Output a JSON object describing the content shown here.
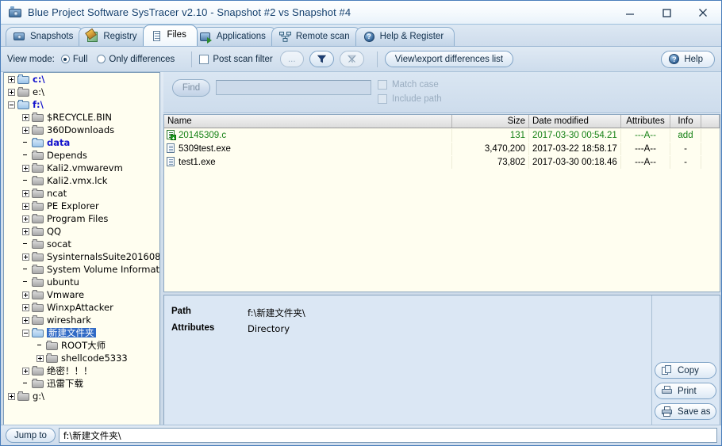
{
  "window": {
    "title": "Blue Project Software SysTracer v2.10 - Snapshot #2 vs Snapshot #4",
    "icon": "camera-icon",
    "minimize": "–",
    "maximize": "□",
    "close": "✕"
  },
  "tabs": [
    {
      "label": "Snapshots",
      "icon": "camera-icon",
      "active": false
    },
    {
      "label": "Registry",
      "icon": "registry-icon",
      "active": false
    },
    {
      "label": "Files",
      "icon": "document-icon",
      "active": true
    },
    {
      "label": "Applications",
      "icon": "application-icon",
      "active": false
    },
    {
      "label": "Remote scan",
      "icon": "network-icon",
      "active": false
    },
    {
      "label": "Help & Register",
      "icon": "help-icon",
      "active": false
    }
  ],
  "toolbar": {
    "view_mode_label": "View mode:",
    "radio_full": "Full",
    "radio_only_differences": "Only differences",
    "post_scan_filter": "Post scan filter",
    "ellipsis_button": "...",
    "filter_button": "filter-icon",
    "clear_filter_button": "clear-filter-icon",
    "view_export": "View\\export differences list",
    "help": "Help"
  },
  "find": {
    "button": "Find",
    "value": "",
    "placeholder": "",
    "match_case": "Match case",
    "include_path": "Include path"
  },
  "tree": [
    {
      "label": "c:\\",
      "indent": 0,
      "expander": "plus",
      "changed": true,
      "selected": false,
      "folder": "blue"
    },
    {
      "label": "e:\\",
      "indent": 0,
      "expander": "plus",
      "changed": false,
      "selected": false,
      "folder": "gray"
    },
    {
      "label": "f:\\",
      "indent": 0,
      "expander": "minus",
      "changed": true,
      "selected": false,
      "folder": "blue"
    },
    {
      "label": "$RECYCLE.BIN",
      "indent": 1,
      "expander": "plus",
      "changed": false,
      "selected": false,
      "folder": "gray"
    },
    {
      "label": "360Downloads",
      "indent": 1,
      "expander": "plus",
      "changed": false,
      "selected": false,
      "folder": "gray"
    },
    {
      "label": "data",
      "indent": 1,
      "expander": "none",
      "changed": true,
      "selected": false,
      "folder": "blue"
    },
    {
      "label": "Depends",
      "indent": 1,
      "expander": "none",
      "changed": false,
      "selected": false,
      "folder": "gray"
    },
    {
      "label": "Kali2.vmwarevm",
      "indent": 1,
      "expander": "plus",
      "changed": false,
      "selected": false,
      "folder": "gray"
    },
    {
      "label": "Kali2.vmx.lck",
      "indent": 1,
      "expander": "none",
      "changed": false,
      "selected": false,
      "folder": "gray"
    },
    {
      "label": "ncat",
      "indent": 1,
      "expander": "plus",
      "changed": false,
      "selected": false,
      "folder": "gray"
    },
    {
      "label": "PE Explorer",
      "indent": 1,
      "expander": "plus",
      "changed": false,
      "selected": false,
      "folder": "gray"
    },
    {
      "label": "Program Files",
      "indent": 1,
      "expander": "plus",
      "changed": false,
      "selected": false,
      "folder": "gray"
    },
    {
      "label": "QQ",
      "indent": 1,
      "expander": "plus",
      "changed": false,
      "selected": false,
      "folder": "gray"
    },
    {
      "label": "socat",
      "indent": 1,
      "expander": "none",
      "changed": false,
      "selected": false,
      "folder": "gray"
    },
    {
      "label": "SysinternalsSuite201608",
      "indent": 1,
      "expander": "plus",
      "changed": false,
      "selected": false,
      "folder": "gray"
    },
    {
      "label": "System Volume Information",
      "indent": 1,
      "expander": "none",
      "changed": false,
      "selected": false,
      "folder": "gray"
    },
    {
      "label": "ubuntu",
      "indent": 1,
      "expander": "none",
      "changed": false,
      "selected": false,
      "folder": "gray"
    },
    {
      "label": "Vmware",
      "indent": 1,
      "expander": "plus",
      "changed": false,
      "selected": false,
      "folder": "gray"
    },
    {
      "label": "WinxpAttacker",
      "indent": 1,
      "expander": "plus",
      "changed": false,
      "selected": false,
      "folder": "gray"
    },
    {
      "label": "wireshark",
      "indent": 1,
      "expander": "plus",
      "changed": false,
      "selected": false,
      "folder": "gray"
    },
    {
      "label": "新建文件夹",
      "indent": 1,
      "expander": "minus",
      "changed": true,
      "selected": true,
      "folder": "blue"
    },
    {
      "label": "ROOT大师",
      "indent": 2,
      "expander": "none",
      "changed": false,
      "selected": false,
      "folder": "gray"
    },
    {
      "label": "shellcode5333",
      "indent": 2,
      "expander": "plus",
      "changed": false,
      "selected": false,
      "folder": "gray"
    },
    {
      "label": "绝密！！！",
      "indent": 1,
      "expander": "plus",
      "changed": false,
      "selected": false,
      "folder": "gray"
    },
    {
      "label": "迅雷下载",
      "indent": 1,
      "expander": "none",
      "changed": false,
      "selected": false,
      "folder": "gray"
    },
    {
      "label": "g:\\",
      "indent": 0,
      "expander": "plus",
      "changed": false,
      "selected": false,
      "folder": "gray"
    }
  ],
  "filelist": {
    "columns": [
      "Name",
      "Size",
      "Date modified",
      "Attributes",
      "Info"
    ],
    "rows": [
      {
        "name": "20145309.c",
        "size": "131",
        "date": "2017-03-30 00:54.21",
        "attributes": "---A--",
        "info": "add",
        "state": "added"
      },
      {
        "name": "5309test.exe",
        "size": "3,470,200",
        "date": "2017-03-22 18:58.17",
        "attributes": "---A--",
        "info": "-",
        "state": "normal"
      },
      {
        "name": "test1.exe",
        "size": "73,802",
        "date": "2017-03-30 00:18.46",
        "attributes": "---A--",
        "info": "-",
        "state": "normal"
      }
    ]
  },
  "details": {
    "path_label": "Path",
    "path_value": "f:\\新建文件夹\\",
    "attributes_label": "Attributes",
    "attributes_value": "Directory",
    "buttons": [
      {
        "label": "Copy",
        "icon": "copy-icon"
      },
      {
        "label": "Print",
        "icon": "printer-icon"
      },
      {
        "label": "Save as",
        "icon": "save-icon"
      }
    ]
  },
  "statusbar": {
    "jump_to": "Jump to",
    "path": "f:\\新建文件夹\\"
  },
  "colors": {
    "accent": "#316ac5",
    "changed": "#1414cd",
    "added": "#148014",
    "list_bg": "#fffef0",
    "panel_bg": "#dbe7f4"
  }
}
